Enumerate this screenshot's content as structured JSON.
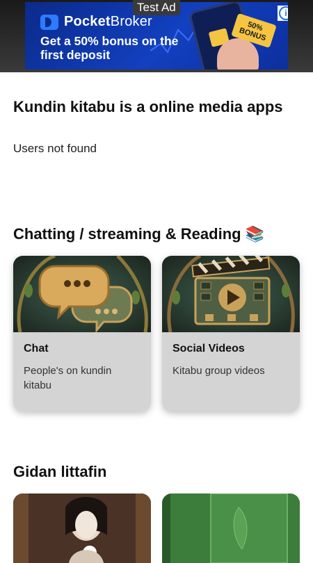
{
  "ad": {
    "label": "Test Ad",
    "brand_bold": "Pocket",
    "brand_rest": "Broker",
    "headline": "Get a 50% bonus on the first deposit",
    "badge": "50% BONUS",
    "info_glyph": "i"
  },
  "app_title": "Kundin kitabu is a online media apps",
  "status_text": "Users not found",
  "section_chat": {
    "title": "Chatting / streaming & Reading 📚",
    "cards": [
      {
        "title": "Chat",
        "description": "People's on kundin kitabu",
        "icon": "chat-bubbles-icon"
      },
      {
        "title": "Social Videos",
        "description": "Kitabu group videos",
        "icon": "video-clapper-icon"
      }
    ]
  },
  "section_books": {
    "title": "Gidan littafin"
  },
  "colors": {
    "card_bg": "#d4d4d4",
    "ad_blue": "#1240c0"
  }
}
